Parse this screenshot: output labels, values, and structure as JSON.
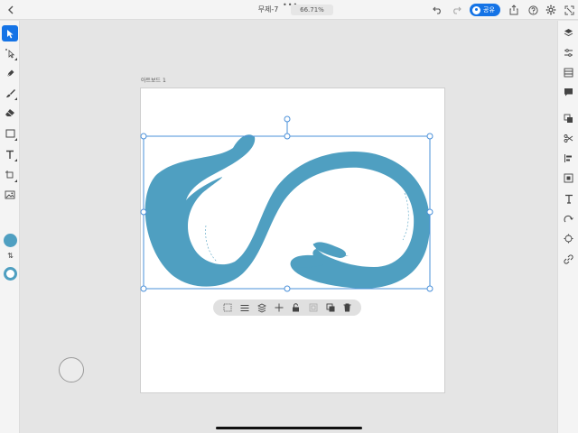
{
  "topbar": {
    "document_title": "무제-7",
    "zoom_level": "66.71%",
    "share_label": "공유",
    "icons": [
      "back-icon",
      "more-dots-icon",
      "undo-icon",
      "redo-icon",
      "export-icon",
      "help-icon",
      "settings-icon",
      "fullscreen-icon"
    ]
  },
  "artboard": {
    "label": "아트보드 1"
  },
  "left_toolbar": {
    "tools": [
      "select-tool-icon",
      "direct-select-tool-icon",
      "pen-tool-icon",
      "brush-tool-icon",
      "eraser-tool-icon",
      "shape-tool-icon",
      "type-tool-icon",
      "transform-tool-icon",
      "image-tool-icon"
    ],
    "fill_color": "#4f9fc1",
    "stroke_color": "#4f9fc1"
  },
  "right_toolbar": {
    "tools": [
      "layers-icon",
      "properties-icon",
      "libraries-icon",
      "comments-icon",
      "pathfinder-icon",
      "scissors-icon",
      "align-icon",
      "transform-icon",
      "type-panel-icon",
      "repeat-icon",
      "effects-icon",
      "link-icon"
    ]
  },
  "context_bar": {
    "actions": [
      "select-similar-icon",
      "menu-lines-icon",
      "stack-icon",
      "move-icon",
      "lock-icon",
      "group-icon",
      "duplicate-icon",
      "delete-icon"
    ]
  },
  "colors": {
    "accent": "#1473e6",
    "artwork": "#4f9fc1"
  }
}
